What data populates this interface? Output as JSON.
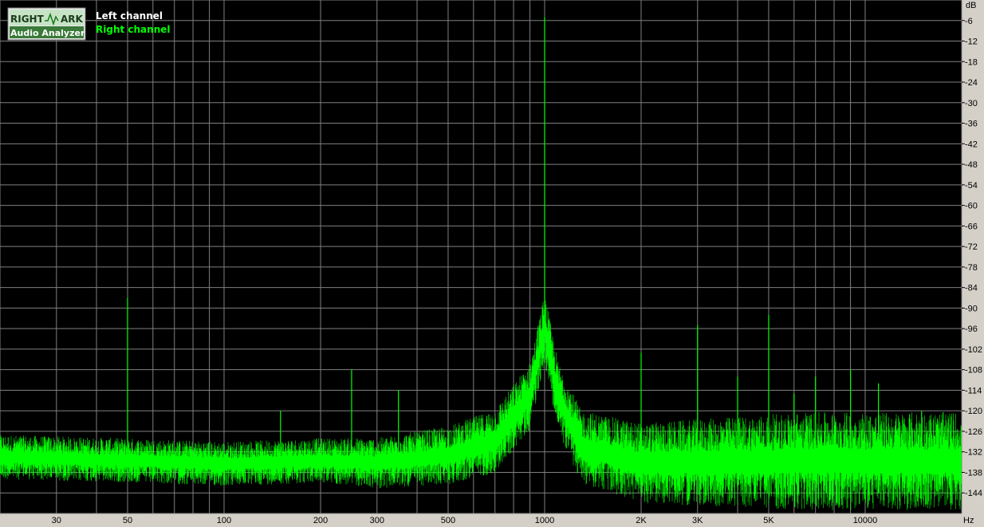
{
  "colors": {
    "background": "#000000",
    "grid": "#808080",
    "panel": "#d4d0c8",
    "left_channel": "#ffffff",
    "right_channel": "#00ff00"
  },
  "logo": {
    "line1_left": "RIGHT",
    "line1_right": "ARK",
    "line2": "Audio Analyzer"
  },
  "legend": {
    "left": "Left channel",
    "right": "Right channel"
  },
  "chart_data": {
    "type": "line",
    "x_scale": "log",
    "xlim": [
      20,
      20000
    ],
    "ylim": [
      -150,
      0
    ],
    "xlabel": "Hz",
    "ylabel": "dB",
    "grid": true,
    "legend_position": "top-left",
    "x_ticks": [
      {
        "value": 30,
        "label": "30"
      },
      {
        "value": 50,
        "label": "50"
      },
      {
        "value": 100,
        "label": "100"
      },
      {
        "value": 200,
        "label": "200"
      },
      {
        "value": 300,
        "label": "300"
      },
      {
        "value": 500,
        "label": "500"
      },
      {
        "value": 1000,
        "label": "1000"
      },
      {
        "value": 2000,
        "label": "2K"
      },
      {
        "value": 3000,
        "label": "3K"
      },
      {
        "value": 5000,
        "label": "5K"
      },
      {
        "value": 10000,
        "label": "10000"
      }
    ],
    "y_ticks": [
      -6,
      -12,
      -18,
      -24,
      -30,
      -36,
      -42,
      -48,
      -54,
      -60,
      -66,
      -72,
      -78,
      -84,
      -90,
      -96,
      -102,
      -108,
      -114,
      -120,
      -126,
      -132,
      -138,
      -144
    ],
    "series": [
      {
        "name": "Right channel",
        "color": "#00ff00",
        "noise_floor": [
          [
            20,
            -135
          ],
          [
            50,
            -136
          ],
          [
            100,
            -137
          ],
          [
            200,
            -136
          ],
          [
            300,
            -137
          ],
          [
            500,
            -135
          ],
          [
            700,
            -131
          ],
          [
            900,
            -118
          ],
          [
            1000,
            -98
          ],
          [
            1100,
            -118
          ],
          [
            1300,
            -133
          ],
          [
            2000,
            -138
          ],
          [
            3000,
            -138
          ],
          [
            5000,
            -138
          ],
          [
            10000,
            -138
          ],
          [
            20000,
            -138
          ]
        ],
        "peaks": [
          [
            50,
            -87
          ],
          [
            150,
            -120
          ],
          [
            250,
            -108
          ],
          [
            350,
            -114
          ],
          [
            1000,
            -5
          ],
          [
            2000,
            -103
          ],
          [
            3000,
            -95
          ],
          [
            4000,
            -110
          ],
          [
            5000,
            -92
          ],
          [
            6000,
            -115
          ],
          [
            7000,
            -110
          ],
          [
            9000,
            -108
          ],
          [
            11000,
            -112
          ],
          [
            15000,
            -120
          ]
        ]
      }
    ]
  }
}
